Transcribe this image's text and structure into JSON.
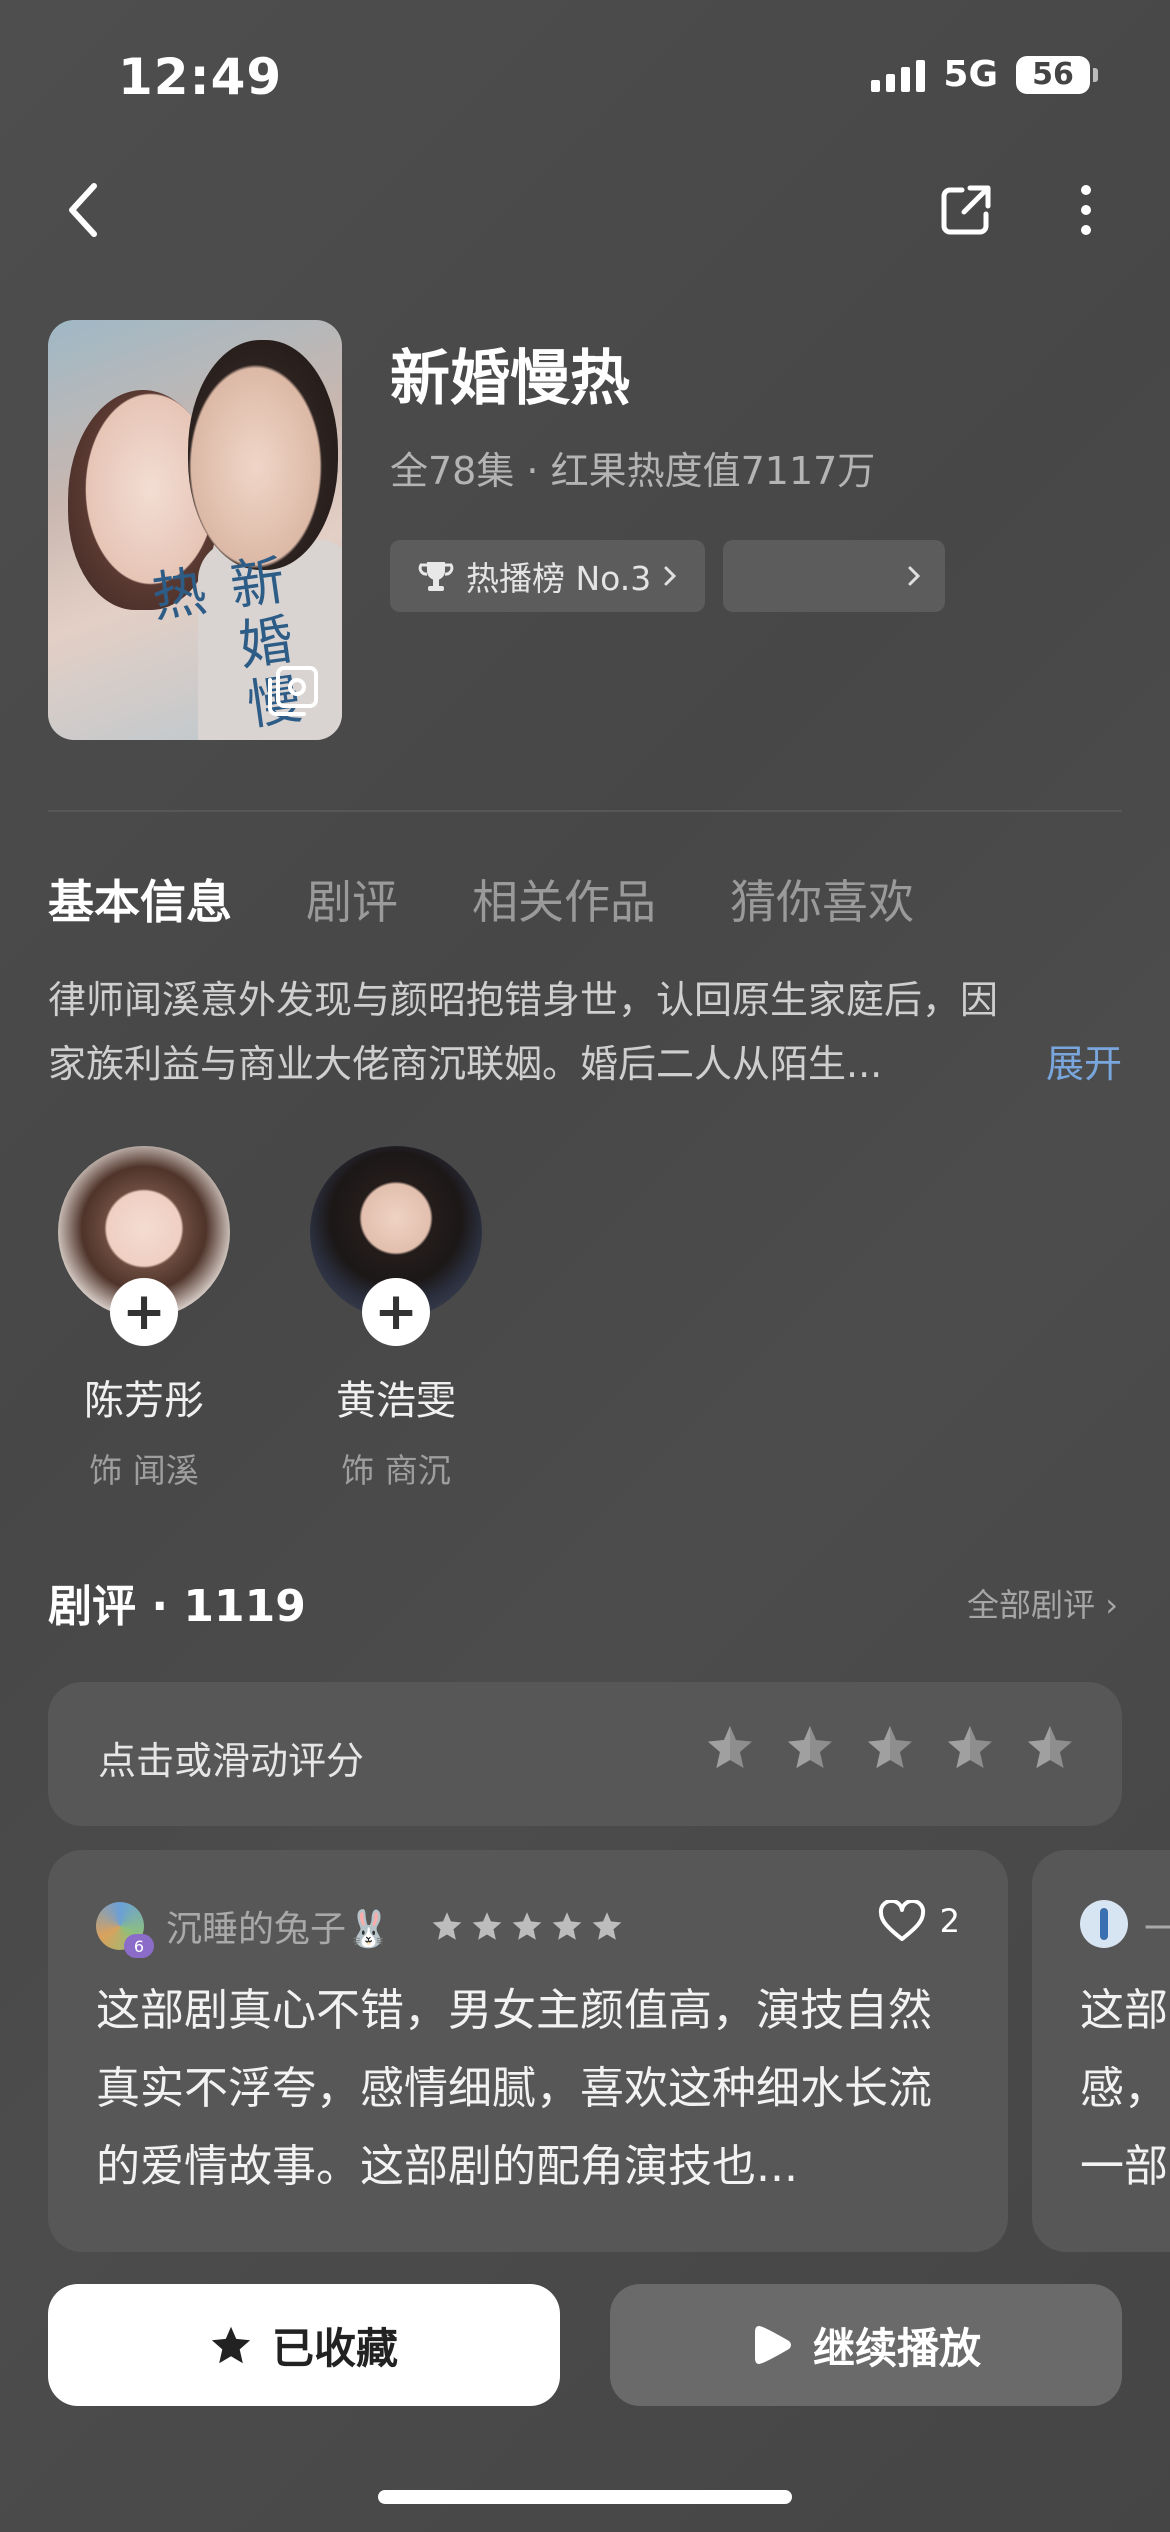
{
  "status": {
    "time": "12:49",
    "network": "5G",
    "battery": "56"
  },
  "show": {
    "title": "新婚慢热",
    "meta": "全78集 · 红果热度值7117万",
    "rank_label": "热播榜 No.3"
  },
  "tabs": [
    "基本信息",
    "剧评",
    "相关作品",
    "猜你喜欢"
  ],
  "synopsis": {
    "line1": "律师闻溪意外发现与颜昭抱错身世，认回原生家庭后，因",
    "line2": "家族利益与商业大佬商沉联姻。婚后二人从陌生...",
    "more": "展开"
  },
  "cast": [
    {
      "name": "陈芳彤",
      "role": "饰 闻溪"
    },
    {
      "name": "黄浩雯",
      "role": "饰 商沉"
    }
  ],
  "reviews": {
    "heading": "剧评 · 1119",
    "all_link": "全部剧评",
    "rate_prompt": "点击或滑动评分",
    "items": [
      {
        "user": "沉睡的兔子🐰",
        "level": "6",
        "stars": 5,
        "likes": "2",
        "text": "这部剧真心不错，男女主颜值高，演技自然真实不浮夸，感情细腻，喜欢这种细水长流的爱情故事。这部剧的配角演技也..."
      },
      {
        "user": "一",
        "text": "这部感，一部"
      }
    ]
  },
  "actions": {
    "favorite": "已收藏",
    "play": "继续播放"
  }
}
